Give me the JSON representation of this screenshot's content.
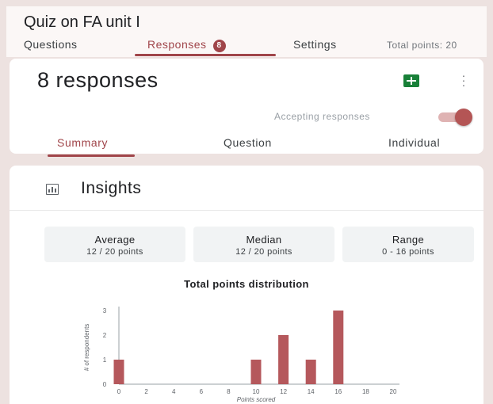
{
  "form": {
    "title": "Quiz on FA unit I"
  },
  "tabs": [
    {
      "label": "Questions"
    },
    {
      "label": "Responses",
      "badge": "8"
    },
    {
      "label": "Settings"
    }
  ],
  "total_points_text": "Total points: 20",
  "responses": {
    "title": "8 responses",
    "accepting_label": "Accepting responses",
    "accepting_on": true,
    "subtabs": [
      "Summary",
      "Question",
      "Individual"
    ]
  },
  "insights": {
    "title": "Insights",
    "stats": [
      {
        "label": "Average",
        "value": "12 / 20 points"
      },
      {
        "label": "Median",
        "value": "12 / 20 points"
      },
      {
        "label": "Range",
        "value": "0 - 16 points"
      }
    ]
  },
  "colors": {
    "accent": "#a0454a",
    "bar": "#b5585c",
    "sheets": "#188038"
  },
  "chart_data": {
    "type": "bar",
    "title": "Total points distribution",
    "xlabel": "Points scored",
    "ylabel": "# of respondents",
    "x": [
      0,
      10,
      12,
      14,
      16
    ],
    "values": [
      1,
      1,
      2,
      1,
      3
    ],
    "xticks": [
      0,
      2,
      4,
      6,
      8,
      10,
      12,
      14,
      16,
      18,
      20
    ],
    "yticks": [
      0,
      1,
      2,
      3
    ],
    "xlim": [
      0,
      20
    ],
    "ylim": [
      0,
      3
    ]
  }
}
